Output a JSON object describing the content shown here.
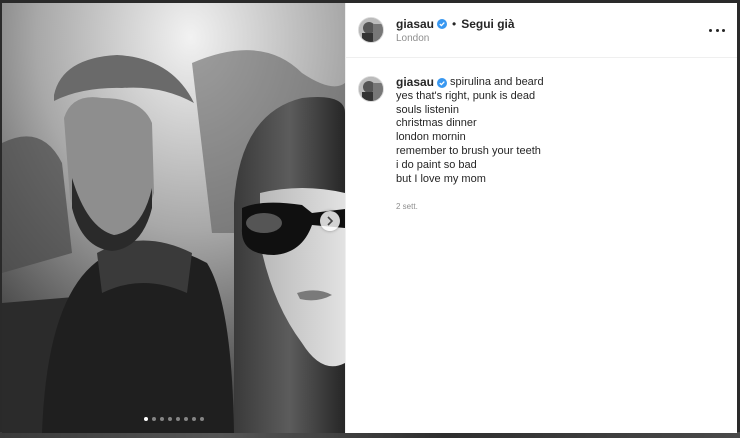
{
  "post": {
    "header": {
      "username": "giasau",
      "separator": "•",
      "follow_state": "Segui già",
      "location": "London"
    },
    "caption": {
      "username": "giasau",
      "first_line": "spirulina and beard",
      "lines": [
        "yes that's right, punk is dead",
        "souls listenin",
        "christmas dinner",
        "london mornin",
        "remember to brush your teeth",
        "i do paint so bad",
        "but I love my mom"
      ],
      "time_ago": "2 sett."
    },
    "carousel": {
      "slide_count": 8,
      "current_slide": 1
    },
    "icons": {
      "verified": "verified-badge-icon",
      "more": "more-options-icon",
      "next": "chevron-right-icon"
    },
    "colors": {
      "verified": "#3897f0",
      "text": "#262626",
      "secondary": "#8e8e8e"
    }
  }
}
